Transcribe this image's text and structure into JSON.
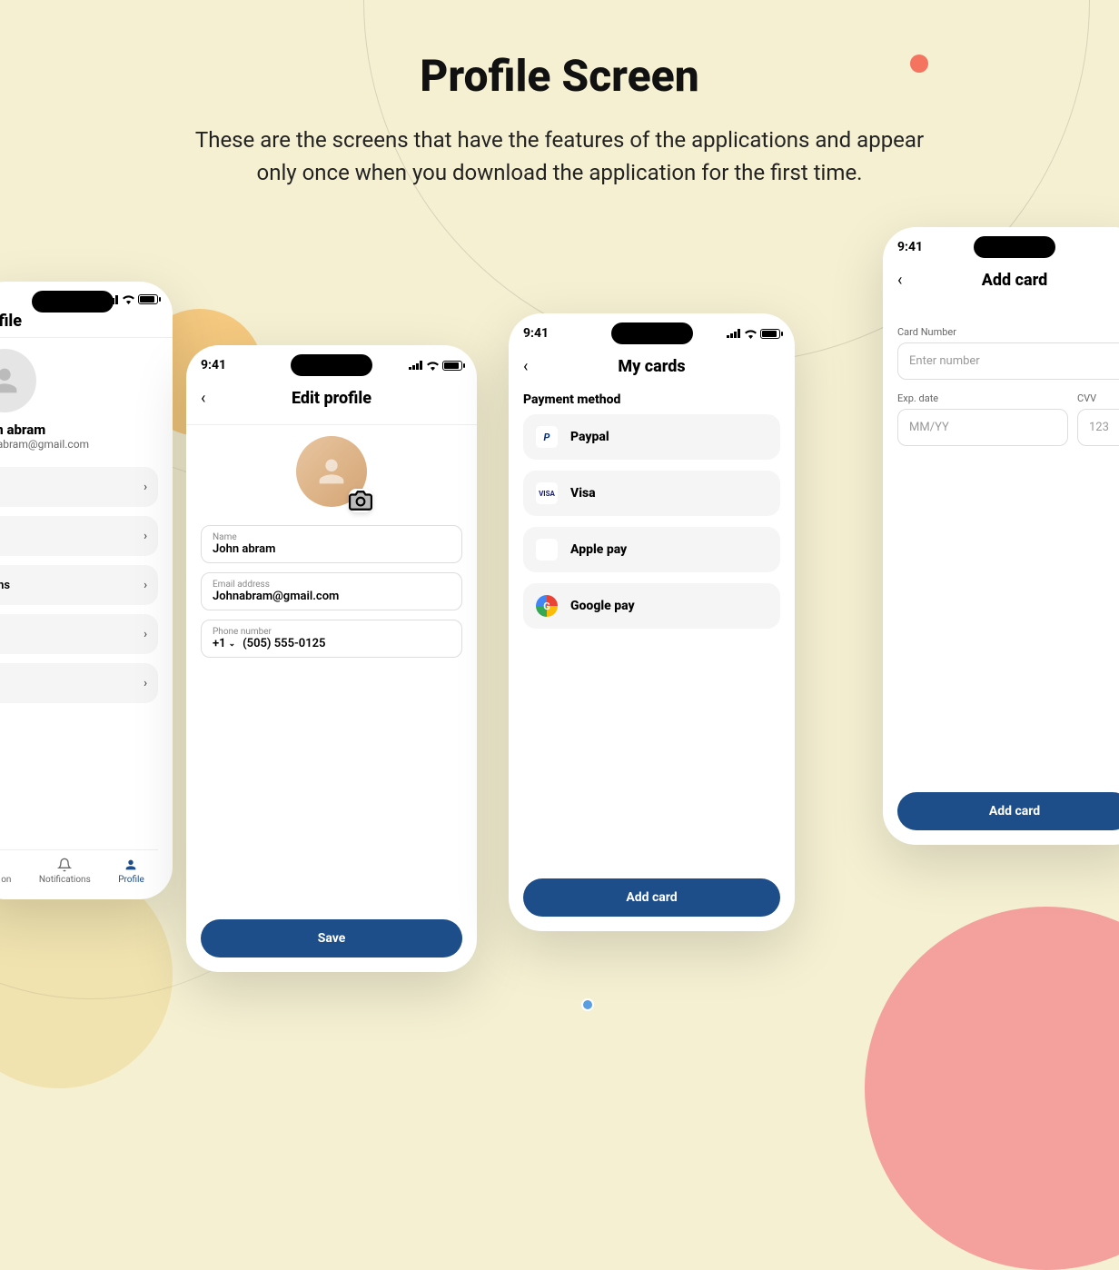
{
  "page": {
    "title": "Profile Screen",
    "subtitle": "These are the screens that have the features of the applications and appear only  once when you download the application for the first time."
  },
  "status": {
    "time": "9:41"
  },
  "profile": {
    "title": "Profile",
    "name": "John abram",
    "email": "Johnabram@gmail.com",
    "menu_item_2": "tions",
    "nav": {
      "notifications": "Notifications",
      "profile": "Profile",
      "nav0": "on"
    }
  },
  "edit": {
    "title": "Edit profile",
    "name_label": "Name",
    "name_value": "John abram",
    "email_label": "Email address",
    "email_value": "Johnabram@gmail.com",
    "phone_label": "Phone number",
    "phone_code": "+1",
    "phone_value": "(505) 555-0125",
    "save": "Save"
  },
  "cards": {
    "title": "My cards",
    "section": "Payment method",
    "paypal": "Paypal",
    "visa": "Visa",
    "apple": "Apple pay",
    "google": "Google pay",
    "add": "Add card"
  },
  "addcard": {
    "title": "Add card",
    "num_label": "Card Number",
    "num_ph": "Enter number",
    "exp_label": "Exp. date",
    "exp_ph": "MM/YY",
    "cvv_label": "CVV",
    "cvv_ph": "123",
    "btn": "Add card"
  }
}
